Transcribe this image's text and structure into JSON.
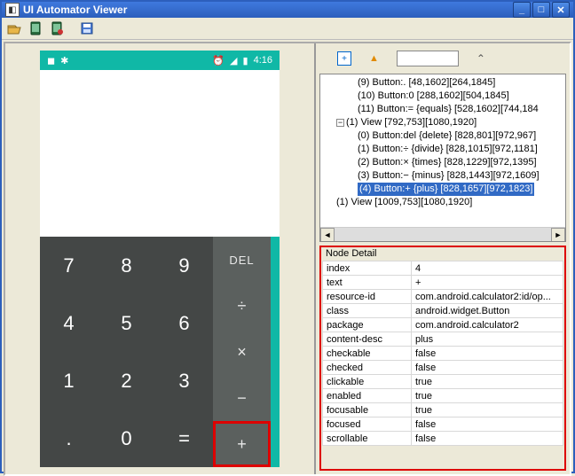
{
  "window": {
    "title": "UI Automator Viewer"
  },
  "device": {
    "statusbar": {
      "time": "4:16"
    },
    "keys": {
      "d7": "7",
      "d8": "8",
      "d9": "9",
      "d4": "4",
      "d5": "5",
      "d6": "6",
      "d1": "1",
      "d2": "2",
      "d3": "3",
      "dot": ".",
      "d0": "0",
      "eq": "=",
      "del": "DEL",
      "div": "÷",
      "mul": "×",
      "min": "−",
      "plus": "+"
    }
  },
  "tree": [
    "(9) Button:. [48,1602][264,1845]",
    "(10) Button:0 [288,1602][504,1845]",
    "(11) Button:= {equals} [528,1602][744,184",
    "(1) View [792,753][1080,1920]",
    "(0) Button:del {delete} [828,801][972,967]",
    "(1) Button:÷ {divide} [828,1015][972,1181]",
    "(2) Button:× {times} [828,1229][972,1395]",
    "(3) Button:− {minus} [828,1443][972,1609]",
    "(4) Button:+ {plus} [828,1657][972,1823]",
    "(1) View [1009,753][1080,1920]"
  ],
  "detail": {
    "title": "Node Detail",
    "rows": [
      {
        "k": "index",
        "v": "4",
        "hl": true
      },
      {
        "k": "text",
        "v": "+",
        "hl": true
      },
      {
        "k": "resource-id",
        "v": "com.android.calculator2:id/op...",
        "hl": true
      },
      {
        "k": "class",
        "v": "android.widget.Button",
        "hl": true
      },
      {
        "k": "package",
        "v": "com.android.calculator2",
        "hl": true
      },
      {
        "k": "content-desc",
        "v": "plus",
        "hl": true
      },
      {
        "k": "checkable",
        "v": "false",
        "hl": false
      },
      {
        "k": "checked",
        "v": "false",
        "hl": false
      },
      {
        "k": "clickable",
        "v": "true",
        "hl": false
      },
      {
        "k": "enabled",
        "v": "true",
        "hl": false
      },
      {
        "k": "focusable",
        "v": "true",
        "hl": false
      },
      {
        "k": "focused",
        "v": "false",
        "hl": false
      },
      {
        "k": "scrollable",
        "v": "false",
        "hl": false
      }
    ]
  }
}
